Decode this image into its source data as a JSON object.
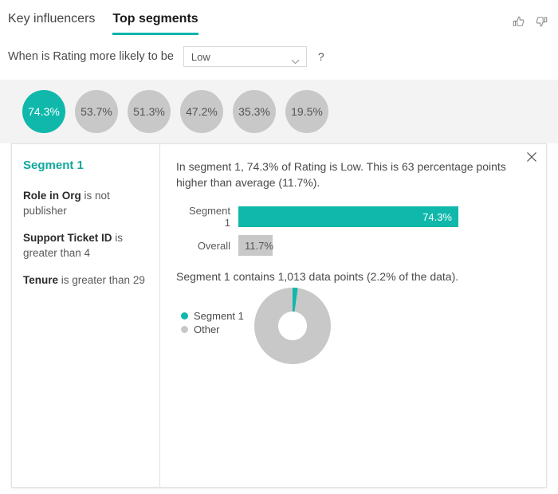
{
  "header": {
    "tabs": [
      {
        "label": "Key influencers",
        "active": false
      },
      {
        "label": "Top segments",
        "active": true
      }
    ],
    "feedback": {
      "thumbs_up": "thumbs-up-icon",
      "thumbs_down": "thumbs-down-icon"
    }
  },
  "filter": {
    "label": "When is Rating more likely to be",
    "dropdown_value": "Low",
    "dropdown_icon": "chevron-down-icon",
    "help": "?"
  },
  "bubbles": [
    {
      "value": "74.3%",
      "selected": true
    },
    {
      "value": "53.7%",
      "selected": false
    },
    {
      "value": "51.3%",
      "selected": false
    },
    {
      "value": "47.2%",
      "selected": false
    },
    {
      "value": "35.3%",
      "selected": false
    },
    {
      "value": "19.5%",
      "selected": false
    }
  ],
  "segment_panel": {
    "title": "Segment 1",
    "conditions": [
      {
        "field": "Role in Org",
        "rest": " is not publisher"
      },
      {
        "field": "Support Ticket ID",
        "rest": " is greater than 4"
      },
      {
        "field": "Tenure",
        "rest": " is greater than 29"
      }
    ]
  },
  "detail_panel": {
    "close_icon": "close-icon",
    "description": "In segment 1, 74.3% of Rating is Low. This is 63 percentage points higher than average (11.7%).",
    "datapoints_text": "Segment 1 contains 1,013 data points (2.2% of the data)."
  },
  "chart_data": [
    {
      "type": "bar",
      "orientation": "horizontal",
      "title": "",
      "categories": [
        "Segment 1",
        "Overall"
      ],
      "values": [
        74.3,
        11.7
      ],
      "value_labels": [
        "74.3%",
        "11.7%"
      ],
      "colors": [
        "#0fb8ab",
        "#c8c8c8"
      ],
      "xlabel": "",
      "ylabel": "",
      "xlim": [
        0,
        74.3
      ],
      "grid": false,
      "legend": "none"
    },
    {
      "type": "pie",
      "subtype": "donut",
      "title": "",
      "categories": [
        "Segment 1",
        "Other"
      ],
      "values": [
        2.2,
        97.8
      ],
      "colors": [
        "#0fb8ab",
        "#c8c8c8"
      ],
      "legend": "left",
      "legend_entries": [
        "Segment 1",
        "Other"
      ]
    }
  ],
  "colors": {
    "accent_teal": "#0fb8ab",
    "segment_title_teal": "#0fa99c",
    "gray": "#c8c8c8",
    "strip_bg": "#f3f3f3"
  }
}
